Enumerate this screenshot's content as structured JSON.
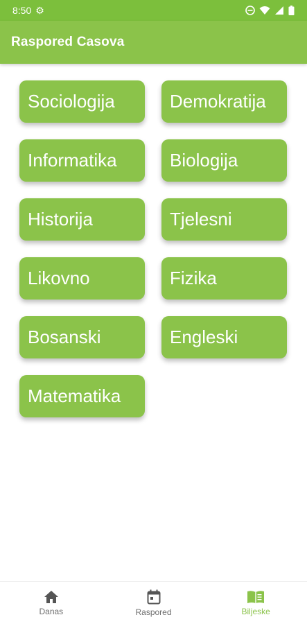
{
  "status_bar": {
    "time": "8:50",
    "icons": [
      "gear-icon",
      "do-not-disturb-icon",
      "wifi-icon",
      "signal-icon",
      "battery-icon"
    ]
  },
  "app_bar": {
    "title": "Raspored Casova"
  },
  "subjects": [
    "Sociologija",
    "Demokratija",
    "Informatika",
    "Biologija",
    "Historija",
    "Tjelesni",
    "Likovno",
    "Fizika",
    "Bosanski",
    "Engleski",
    "Matematika"
  ],
  "bottom_nav": {
    "items": [
      {
        "label": "Danas",
        "icon": "home-icon",
        "active": false
      },
      {
        "label": "Raspored",
        "icon": "calendar-icon",
        "active": false
      },
      {
        "label": "Biljeske",
        "icon": "book-icon",
        "active": true
      }
    ]
  },
  "colors": {
    "primary": "#8bc34a",
    "status_bar": "#7cbf3c",
    "nav_inactive": "#6d6d6d",
    "nav_active": "#8bc34a"
  }
}
